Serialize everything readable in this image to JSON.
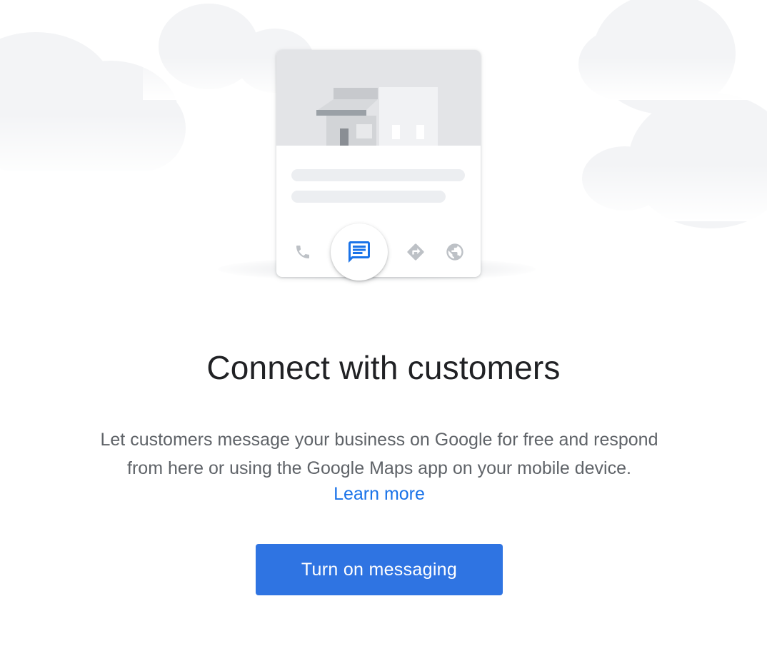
{
  "illustration": {
    "action_icons": [
      "phone-icon",
      "message-icon",
      "directions-icon",
      "website-icon"
    ]
  },
  "main": {
    "title": "Connect with customers",
    "description_line1": "Let customers message your business on Google for free and respond",
    "description_line2": "from here or using the Google Maps app on your mobile device.",
    "learn_more": "Learn more",
    "cta_label": "Turn on messaging"
  },
  "colors": {
    "accent": "#1a73e8",
    "button": "#2f74e2",
    "title_text": "#202124",
    "body_text": "#5f6368"
  }
}
